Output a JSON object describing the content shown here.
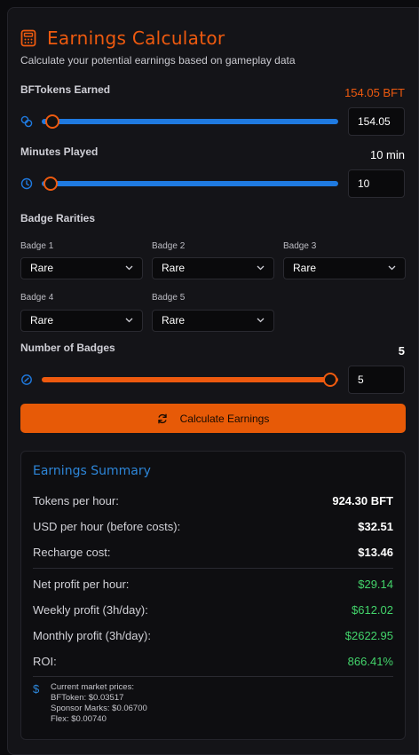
{
  "header": {
    "title": "Earnings Calculator",
    "subtitle": "Calculate your potential earnings based on gameplay data"
  },
  "bf_tokens": {
    "label": "BFTokens Earned",
    "display": "154.05 BFT",
    "input_value": "154.05",
    "slider_fraction": 0.03
  },
  "minutes": {
    "label": "Minutes Played",
    "display": "10 min",
    "input_value": "10",
    "slider_fraction": 0.0
  },
  "badges": {
    "heading": "Badge Rarities",
    "items": [
      {
        "label": "Badge 1",
        "value": "Rare"
      },
      {
        "label": "Badge 2",
        "value": "Rare"
      },
      {
        "label": "Badge 3",
        "value": "Rare"
      },
      {
        "label": "Badge 4",
        "value": "Rare"
      },
      {
        "label": "Badge 5",
        "value": "Rare"
      }
    ]
  },
  "num_badges": {
    "label": "Number of Badges",
    "display": "5",
    "input_value": "5",
    "slider_fraction": 1.0
  },
  "calculate_label": "Calculate Earnings",
  "summary": {
    "title": "Earnings Summary",
    "tokens_per_hour": {
      "label": "Tokens per hour:",
      "value": "924.30 BFT"
    },
    "usd_per_hour": {
      "label": "USD per hour (before costs):",
      "value": "$32.51"
    },
    "recharge_cost": {
      "label": "Recharge cost:",
      "value": "$13.46"
    },
    "net_profit": {
      "label": "Net profit per hour:",
      "value": "$29.14"
    },
    "weekly_profit": {
      "label": "Weekly profit (3h/day):",
      "value": "$612.02"
    },
    "monthly_profit": {
      "label": "Monthly profit (3h/day):",
      "value": "$2622.95"
    },
    "roi": {
      "label": "ROI:",
      "value": "866.41%"
    },
    "prices": {
      "heading": "Current market prices:",
      "bftoken": "BFToken: $0.03517",
      "sponsor_marks": "Sponsor Marks: $0.06700",
      "flex": "Flex: $0.00740"
    }
  },
  "colors": {
    "accent": "#ee5a0f",
    "blue": "#1f7ae0",
    "green": "#43d46b",
    "button": "#e75a07"
  }
}
